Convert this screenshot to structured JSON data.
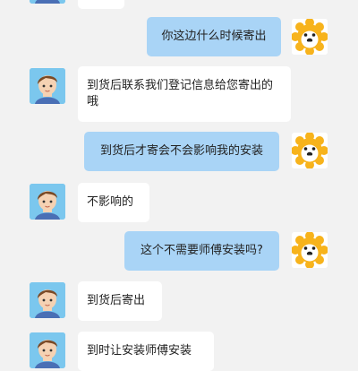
{
  "messages": [
    {
      "sender": "agent",
      "text": ""
    },
    {
      "sender": "user",
      "text": "你这边什么时候寄出"
    },
    {
      "sender": "agent",
      "text": "到货后联系我们登记信息给您寄出的哦"
    },
    {
      "sender": "user",
      "text": "到货后才寄会不会影响我的安装"
    },
    {
      "sender": "agent",
      "text": "不影响的"
    },
    {
      "sender": "user",
      "text": "这个不需要师傅安装吗?"
    },
    {
      "sender": "agent",
      "text": "到货后寄出"
    },
    {
      "sender": "agent",
      "text": "到时让安装师傅安装"
    }
  ],
  "icons": {
    "agent_avatar": "boy-avatar-icon",
    "user_avatar": "lion-avatar-icon"
  },
  "colors": {
    "background": "#f2f2f2",
    "user_bubble": "#a9d4f6",
    "agent_bubble": "#ffffff",
    "lion": "#f7b31c"
  }
}
